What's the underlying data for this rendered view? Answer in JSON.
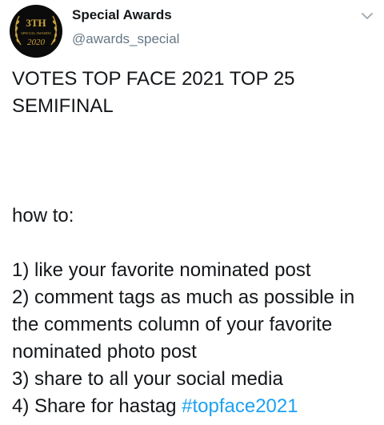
{
  "account": {
    "avatar_line1": "3TH",
    "avatar_line2": "SPECIAL AWARDS",
    "avatar_line3": "2020",
    "display_name": "Special Awards",
    "handle": "@awards_special"
  },
  "tweet": {
    "title": "VOTES TOP FACE 2021 TOP 25 SEMIFINAL",
    "how_to": "how to:",
    "steps": [
      "1) like your favorite nominated post",
      "2) comment tags as much as possible in the comments column of your favorite nominated photo post",
      "3) share to all your social media"
    ],
    "step4_prefix": "4) Share for hastag ",
    "hashtag": "#topface2021"
  },
  "icons": {
    "more_menu": "chevron-down-icon",
    "avatar_decoration": "laurel-icon"
  },
  "colors": {
    "text": "#14171a",
    "secondary_text": "#657786",
    "link": "#1da1f2",
    "gold": "#c9a23c"
  }
}
